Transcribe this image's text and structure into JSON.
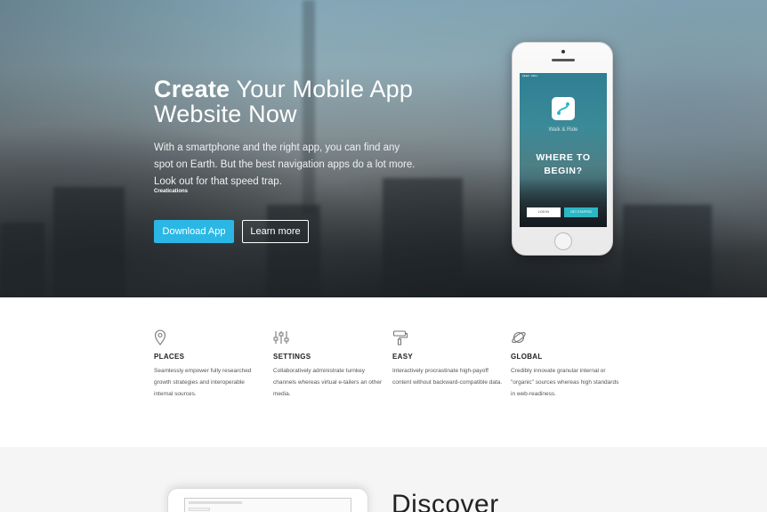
{
  "hero": {
    "title_bold": "Create",
    "title_rest": " Your Mobile App Website Now",
    "text": "With a smartphone and the right app, you can find any spot on Earth. But the best navigation apps do a lot more. Look out for that speed trap.",
    "credit": "Creatications",
    "download_label": "Download App",
    "learn_label": "Learn more",
    "accent_color": "#2bb7e6"
  },
  "phone": {
    "status": "●●●●○ CELL",
    "app_name": "Walk & Ride",
    "headline": "WHERE TO BEGIN?",
    "login_label": "LOG IN",
    "start_label": "GET STARTED",
    "logo_icon": "route-icon"
  },
  "features": [
    {
      "icon": "map-pin-icon",
      "title": "PLACES",
      "text": "Seamlessly empower fully researched growth strategies and interoperable internal sources."
    },
    {
      "icon": "sliders-icon",
      "title": "SETTINGS",
      "text": "Collaboratively administrate turnkey channels whereas virtual e-tailers an other media."
    },
    {
      "icon": "paint-roller-icon",
      "title": "EASY",
      "text": "Interactively procrastinate high-payoff content without backward-compatible data."
    },
    {
      "icon": "planet-icon",
      "title": "GLOBAL",
      "text": "Credibly innovate granular internal or \"organic\" sources whereas high standards in web-readiness."
    }
  ],
  "discover": {
    "title": "Discover"
  }
}
